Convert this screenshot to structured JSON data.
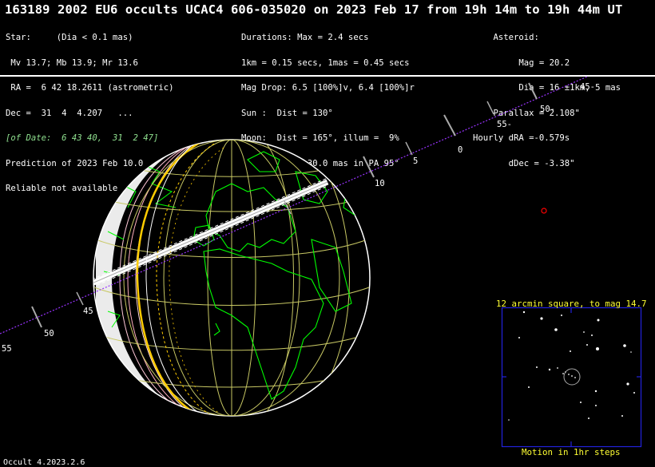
{
  "header": {
    "title": "163189 2002 EU6 occults UCAC4 606-035020 on 2023 Feb 17 from 19h 14m to 19h 44m UT"
  },
  "star_info": [
    "Star:     (Dia < 0.1 mas)",
    " Mv 13.7; Mb 13.9; Mr 13.6",
    " RA =  6 42 18.2611 (astrometric)",
    "Dec =  31  4  4.207   ...",
    "[of Date:  6 43 40,  31  2 47]",
    "Prediction of 2023 Feb 10.0",
    "Reliable not available"
  ],
  "event_info": [
    "Durations: Max = 2.4 secs",
    "1km = 0.15 secs, 1mas = 0.45 secs",
    "Mag Drop: 6.5 [100%]v, 6.4 [100%]r",
    "Sun :  Dist = 130°",
    "Moon:  Dist = 165°, illum =  9%",
    "Error 39.0 x 30.0 mas in PA 95°"
  ],
  "asteroid_info": [
    "    Asteroid:",
    "         Mag = 20.2",
    "         Dia = 16 ±1km, 5 mas",
    "    Parallax = 2.108\"",
    "Hourly dRA =-0.579s",
    "       dDec = -3.38\""
  ],
  "track_labels": [
    {
      "text": "45",
      "suffix": "-"
    },
    {
      "text": "50",
      "suffix": "-"
    },
    {
      "text": "55",
      "suffix": "-"
    },
    {
      "text": "0",
      "suffix": ""
    },
    {
      "text": "5",
      "suffix": ""
    },
    {
      "text": "10",
      "suffix": ""
    },
    {
      "text": "45",
      "suffix": ""
    },
    {
      "text": "50",
      "suffix": ""
    },
    {
      "text": "55",
      "suffix": ""
    }
  ],
  "finder_chart": {
    "title": "12 arcmin square, to mag 14.7",
    "caption": "Motion in 1hr steps"
  },
  "footer": {
    "version": "Occult 4.2023.2.6"
  },
  "colors": {
    "background": "#000000",
    "text": "#ffffff",
    "coastline": "#00ff00",
    "grid": "#c8c864",
    "path_band": "#ffffff",
    "twilight_line": "#ffcc00",
    "track": "#9933ff",
    "finder_frame": "#2222dd",
    "finder_text": "#ffff33",
    "target_marker": "#ff0000"
  }
}
